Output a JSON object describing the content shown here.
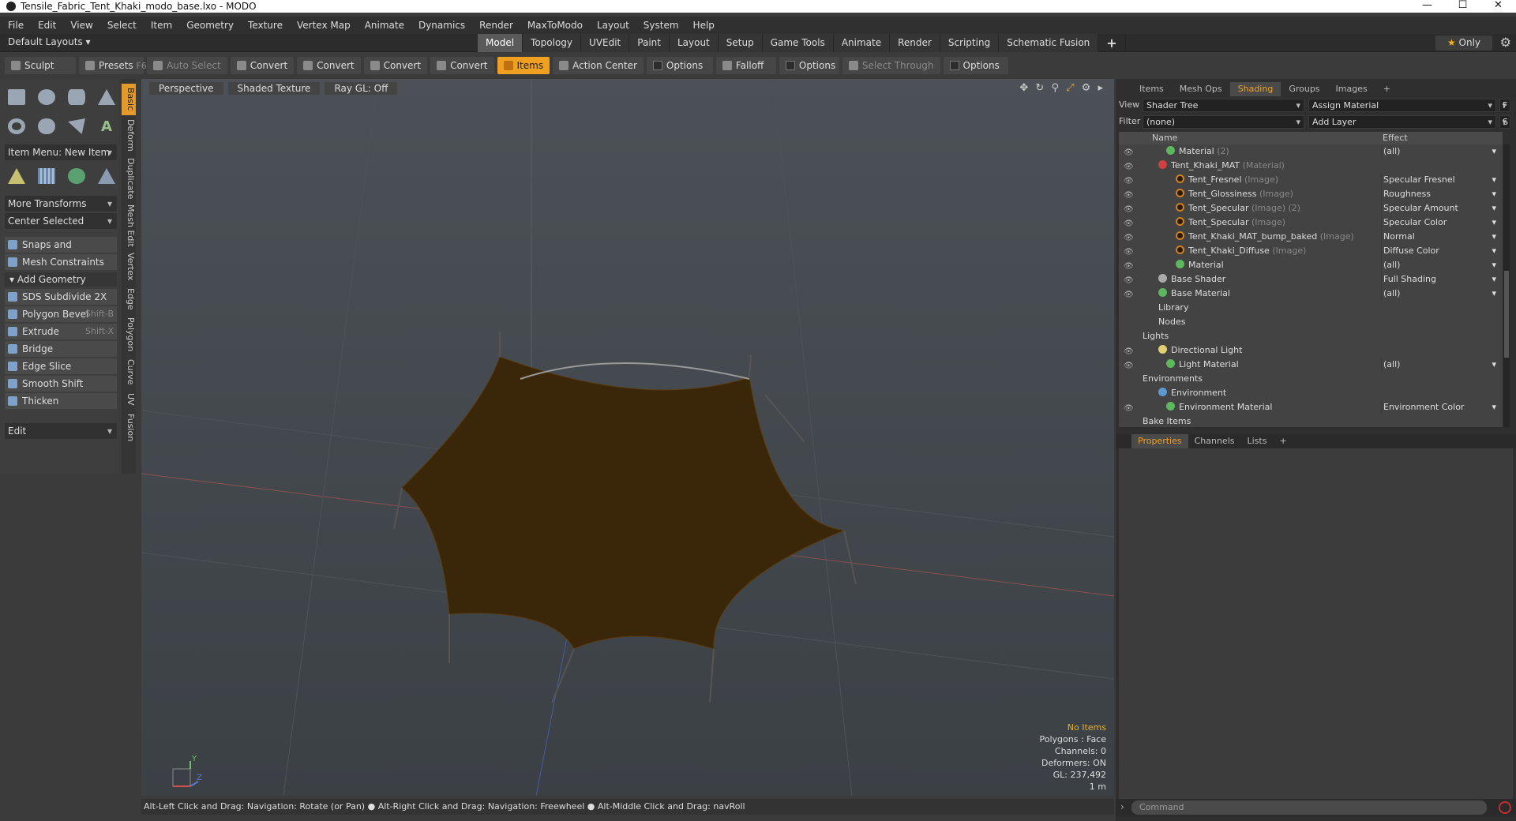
{
  "window": {
    "title": "Tensile_Fabric_Tent_Khaki_modo_base.lxo - MODO",
    "minimize": "—",
    "maximize": "☐",
    "close": "✕"
  },
  "menu": [
    "File",
    "Edit",
    "View",
    "Select",
    "Item",
    "Geometry",
    "Texture",
    "Vertex Map",
    "Animate",
    "Dynamics",
    "Render",
    "MaxToModo",
    "Layout",
    "System",
    "Help"
  ],
  "layout": {
    "dropdown": "Default Layouts ▾",
    "tabs": [
      "Model",
      "Topology",
      "UVEdit",
      "Paint",
      "Layout",
      "Setup",
      "Game Tools",
      "Animate",
      "Render",
      "Scripting",
      "Schematic Fusion"
    ],
    "active_tab": "Model",
    "add": "+",
    "only": "Only"
  },
  "toolbar": {
    "sculpt": "Sculpt",
    "presets": "Presets",
    "presets_key": "F6",
    "auto_select": "Auto Select",
    "convert": "Convert",
    "items": "Items",
    "action_center": "Action Center",
    "options": "Options",
    "falloff": "Falloff",
    "select_through": "Select Through"
  },
  "left": {
    "item_menu": "Item Menu: New Item",
    "more_transforms": "More Transforms",
    "center_selected": "Center Selected",
    "snaps": "Snaps and Precision",
    "mesh_constraints": "Mesh Constraints",
    "add_geometry": "Add Geometry",
    "tools": [
      {
        "label": "SDS Subdivide 2X",
        "key": ""
      },
      {
        "label": "Polygon Bevel",
        "key": "Shift-B"
      },
      {
        "label": "Extrude",
        "key": "Shift-X"
      },
      {
        "label": "Bridge",
        "key": ""
      },
      {
        "label": "Edge Slice",
        "key": ""
      },
      {
        "label": "Smooth Shift",
        "key": ""
      },
      {
        "label": "Thicken",
        "key": ""
      }
    ],
    "edit": "Edit",
    "vtabs": [
      "Basic",
      "Deform",
      "Duplicate",
      "Mesh Edit",
      "Vertex",
      "Edge",
      "Polygon",
      "Curve",
      "UV",
      "Fusion"
    ]
  },
  "viewport": {
    "perspective": "Perspective",
    "shading": "Shaded Texture",
    "raygl": "Ray GL: Off",
    "stats": {
      "items": "No Items",
      "polygons": "Polygons : Face",
      "channels": "Channels: 0",
      "deformers": "Deformers: ON",
      "gl": "GL: 237,492",
      "scale": "1 m"
    },
    "axis_y": "Y",
    "axis_z": "Z"
  },
  "status": "Alt-Left Click and Drag: Navigation: Rotate (or Pan) ● Alt-Right Click and Drag: Navigation: Freewheel ● Alt-Middle Click and Drag: navRoll",
  "right": {
    "tabs": [
      "Items",
      "Mesh Ops",
      "Shading",
      "Groups",
      "Images"
    ],
    "active_tab": "Shading",
    "add": "+",
    "view_label": "View",
    "view_value": "Shader Tree",
    "assign": "Assign Material",
    "f_btn": "F",
    "filter_label": "Filter",
    "filter_value": "(none)",
    "add_layer": "Add Layer",
    "s_btn": "S",
    "col_name": "Name",
    "col_effect": "Effect",
    "tree": [
      {
        "name": "Material",
        "sub": "(2)",
        "effect": "(all)",
        "ball": "green",
        "indent": 60,
        "eye": true,
        "dd": true
      },
      {
        "name": "Tent_Khaki_MAT",
        "sub": "(Material)",
        "effect": "",
        "ball": "red",
        "indent": 50,
        "eye": true,
        "dd": false
      },
      {
        "name": "Tent_Fresnel",
        "sub": "(Image)",
        "effect": "Specular Fresnel",
        "ball": "img",
        "indent": 72,
        "eye": true,
        "dd": true
      },
      {
        "name": "Tent_Glossiness",
        "sub": "(Image)",
        "effect": "Roughness",
        "ball": "img",
        "indent": 72,
        "eye": true,
        "dd": true
      },
      {
        "name": "Tent_Specular",
        "sub": "(Image) (2)",
        "effect": "Specular Amount",
        "ball": "img",
        "indent": 72,
        "eye": true,
        "dd": true
      },
      {
        "name": "Tent_Specular",
        "sub": "(Image)",
        "effect": "Specular Color",
        "ball": "img",
        "indent": 72,
        "eye": true,
        "dd": true
      },
      {
        "name": "Tent_Khaki_MAT_bump_baked",
        "sub": "(Image)",
        "effect": "Normal",
        "ball": "img",
        "indent": 72,
        "eye": true,
        "dd": true
      },
      {
        "name": "Tent_Khaki_Diffuse",
        "sub": "(Image)",
        "effect": "Diffuse Color",
        "ball": "img",
        "indent": 72,
        "eye": true,
        "dd": true
      },
      {
        "name": "Material",
        "sub": "",
        "effect": "(all)",
        "ball": "green",
        "indent": 72,
        "eye": true,
        "dd": true
      },
      {
        "name": "Base Shader",
        "sub": "",
        "effect": "Full Shading",
        "ball": "gray",
        "indent": 50,
        "eye": true,
        "dd": true
      },
      {
        "name": "Base Material",
        "sub": "",
        "effect": "(all)",
        "ball": "green",
        "indent": 50,
        "eye": true,
        "dd": true
      },
      {
        "name": "Library",
        "sub": "",
        "effect": "",
        "ball": "",
        "indent": 50,
        "eye": false,
        "dd": false
      },
      {
        "name": "Nodes",
        "sub": "",
        "effect": "",
        "ball": "",
        "indent": 50,
        "eye": false,
        "dd": false
      },
      {
        "name": "Lights",
        "sub": "",
        "effect": "",
        "ball": "",
        "indent": 30,
        "eye": false,
        "dd": false
      },
      {
        "name": "Directional Light",
        "sub": "",
        "effect": "",
        "ball": "light",
        "indent": 50,
        "eye": true,
        "dd": false
      },
      {
        "name": "Light Material",
        "sub": "",
        "effect": "(all)",
        "ball": "green",
        "indent": 60,
        "eye": true,
        "dd": true
      },
      {
        "name": "Environments",
        "sub": "",
        "effect": "",
        "ball": "",
        "indent": 30,
        "eye": false,
        "dd": false
      },
      {
        "name": "Environment",
        "sub": "",
        "effect": "",
        "ball": "env",
        "indent": 50,
        "eye": false,
        "dd": false
      },
      {
        "name": "Environment Material",
        "sub": "",
        "effect": "Environment Color",
        "ball": "green",
        "indent": 60,
        "eye": true,
        "dd": true
      },
      {
        "name": "Bake Items",
        "sub": "",
        "effect": "",
        "ball": "",
        "indent": 30,
        "eye": false,
        "dd": false
      }
    ],
    "ptabs": [
      "Properties",
      "Channels",
      "Lists"
    ],
    "ptab_active": "Properties",
    "command_placeholder": "Command"
  }
}
